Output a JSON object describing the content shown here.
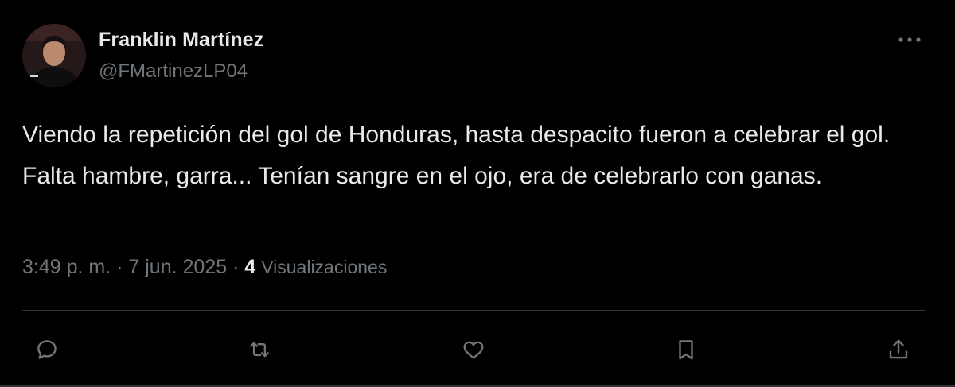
{
  "user": {
    "display_name": "Franklin Martínez",
    "handle": "@FMartinezLP04"
  },
  "tweet": {
    "text": "Viendo la repetición del gol de Honduras, hasta despacito fueron a celebrar el gol. Falta hambre, garra... Tenían sangre en el ojo, era de celebrarlo con ganas.",
    "time": "3:49 p. m.",
    "separator": "·",
    "date": "7 jun. 2025",
    "views_count": "4",
    "views_label": "Visualizaciones"
  },
  "actions": [
    {
      "name": "reply-button",
      "icon": "reply-icon"
    },
    {
      "name": "repost-button",
      "icon": "repost-icon"
    },
    {
      "name": "like-button",
      "icon": "heart-icon"
    },
    {
      "name": "bookmark-button",
      "icon": "bookmark-icon"
    },
    {
      "name": "share-button",
      "icon": "share-icon"
    }
  ],
  "colors": {
    "background": "#000000",
    "primary_text": "#e7e9ea",
    "secondary_text": "#71767b",
    "divider": "#2f3336"
  }
}
